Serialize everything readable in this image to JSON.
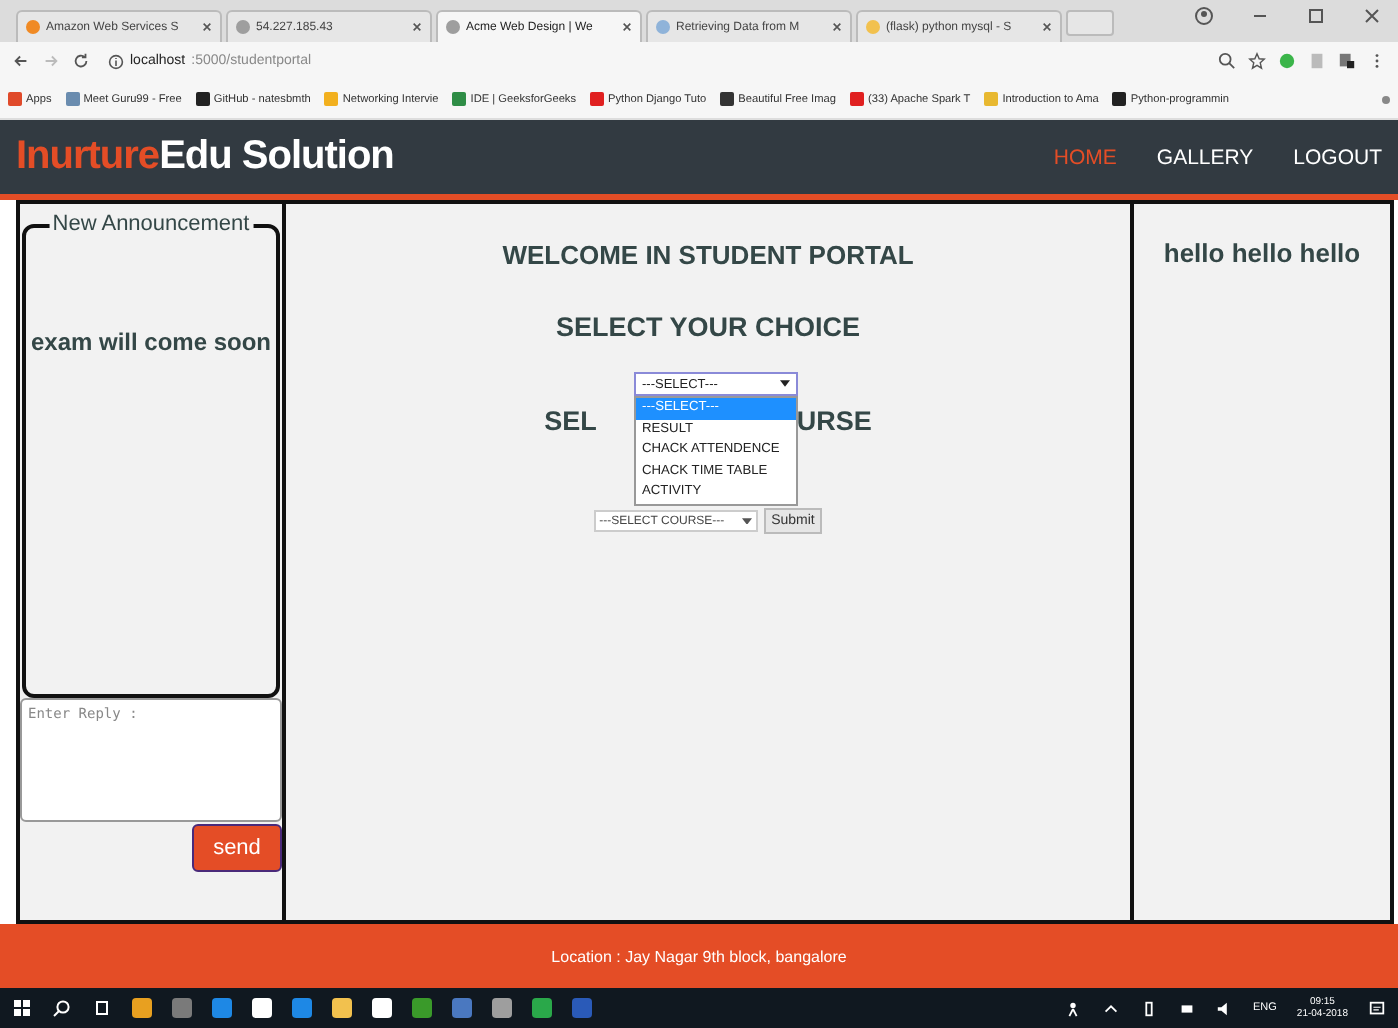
{
  "browser": {
    "tabs": [
      {
        "title": "Amazon Web Services S",
        "color": "#f08a24",
        "selected": false
      },
      {
        "title": "54.227.185.43",
        "color": "#9e9e9e",
        "selected": false
      },
      {
        "title": "Acme Web Design | We",
        "color": "#9e9e9e",
        "selected": true
      },
      {
        "title": "Retrieving Data from M",
        "color": "#8fb3d9",
        "selected": false
      },
      {
        "title": "(flask) python mysql - S",
        "color": "#f2c14e",
        "selected": false
      }
    ],
    "address": {
      "host": "localhost",
      "path": ":5000/studentportal"
    },
    "bookmarks": [
      {
        "label": "Apps",
        "color": "#e04a2a"
      },
      {
        "label": "Meet Guru99 - Free",
        "color": "#6a8caf"
      },
      {
        "label": "GitHub - natesbmth",
        "color": "#222222"
      },
      {
        "label": "Networking Intervie",
        "color": "#f2b01e"
      },
      {
        "label": "IDE | GeeksforGeeks",
        "color": "#2f8d46"
      },
      {
        "label": "Python Django Tuto",
        "color": "#e02020"
      },
      {
        "label": "Beautiful Free Imag",
        "color": "#333333"
      },
      {
        "label": "(33) Apache Spark T",
        "color": "#e02020"
      },
      {
        "label": "Introduction to Ama",
        "color": "#e8b830"
      },
      {
        "label": "Python-programmin",
        "color": "#222222"
      }
    ]
  },
  "nav": {
    "brand_accent": "Inurture",
    "brand": "Edu Solution",
    "links": [
      {
        "label": "HOME",
        "selected": true
      },
      {
        "label": "GALLERY",
        "selected": false
      },
      {
        "label": "LOGOUT",
        "selected": false
      }
    ]
  },
  "left": {
    "legend": "New Announcement",
    "announcement": "exam will come soon",
    "reply": {
      "placeholder": "Enter Reply :"
    },
    "send": "send"
  },
  "center": {
    "title": "WELCOME IN STUDENT PORTAL",
    "choice_heading": "SELECT YOUR CHOICE",
    "choice_select": {
      "value": "---SELECT---",
      "expanded": true,
      "options": [
        {
          "label": "---SELECT---",
          "selected": true
        },
        {
          "label": "RESULT",
          "selected": false
        },
        {
          "label": "CHACK ATTENDENCE",
          "selected": false
        },
        {
          "label": "CHACK TIME TABLE",
          "selected": false
        },
        {
          "label": "ACTIVITY",
          "selected": false
        }
      ]
    },
    "course_heading_left": "SEL",
    "course_heading_right": "URSE",
    "course_select": {
      "value": "---SELECT COURSE---"
    },
    "submit": "Submit"
  },
  "right": {
    "text": "hello hello hello"
  },
  "footer": "Location : Jay Nagar 9th block, bangalore",
  "taskbar": {
    "apps": [
      {
        "color": "#e8a020"
      },
      {
        "color": "#7a7a7a"
      },
      {
        "color": "#1e88e5"
      },
      {
        "color": "#ffffff"
      },
      {
        "color": "#1e88e5"
      },
      {
        "color": "#f2c14e"
      },
      {
        "color": "#ffffff"
      },
      {
        "color": "#3a9a2a"
      },
      {
        "color": "#4a78c0"
      },
      {
        "color": "#9e9e9e"
      },
      {
        "color": "#2aa84a"
      },
      {
        "color": "#2a5ab8"
      }
    ],
    "language": "ENG",
    "time": "09:15",
    "date": "21-04-2018"
  }
}
